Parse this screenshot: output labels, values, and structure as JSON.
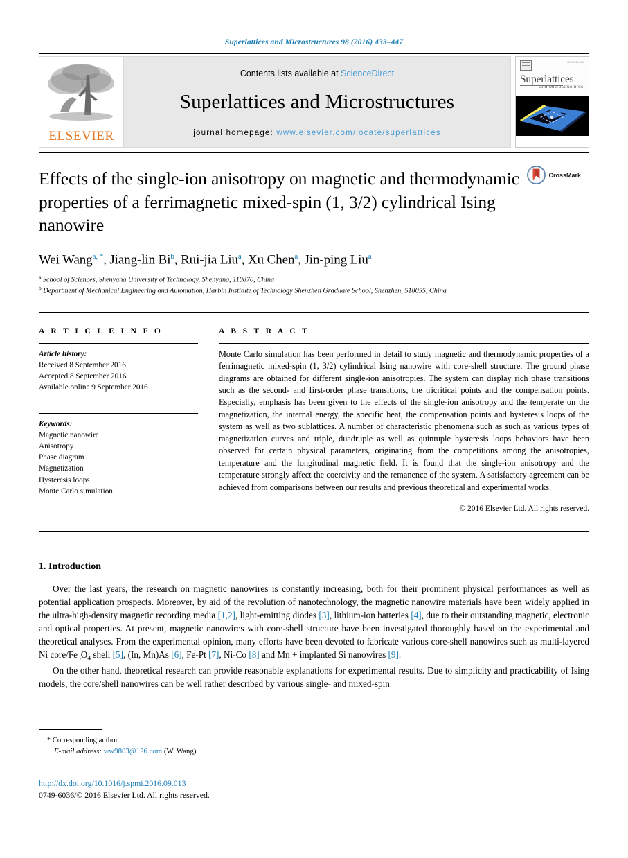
{
  "running_head": "Superlattices and Microstructures 98 (2016) 433–447",
  "masthead": {
    "publisher_logo_name": "ELSEVIER",
    "contents_prefix": "Contents lists available at ",
    "contents_link": "ScienceDirect",
    "journal_title": "Superlattices and Microstructures",
    "homepage_label": "journal homepage: ",
    "homepage_url": "www.elsevier.com/locate/superlattices",
    "cover": {
      "title_main": "Superlattices",
      "title_sub": "and Microstructures"
    }
  },
  "article": {
    "title": "Effects of the single-ion anisotropy on magnetic and thermodynamic properties of a ferrimagnetic mixed-spin (1, 3/2) cylindrical Ising nanowire",
    "crossmark_label": "CrossMark",
    "authors": [
      {
        "name": "Wei Wang",
        "marks": "a, *"
      },
      {
        "name": "Jiang-lin Bi",
        "marks": "b"
      },
      {
        "name": "Rui-jia Liu",
        "marks": "a"
      },
      {
        "name": "Xu Chen",
        "marks": "a"
      },
      {
        "name": "Jin-ping Liu",
        "marks": "a"
      }
    ],
    "affiliations": [
      {
        "mark": "a",
        "text": "School of Sciences, Shenyang University of Technology, Shenyang, 110870, China"
      },
      {
        "mark": "b",
        "text": "Department of Mechanical Engineering and Automation, Harbin Institute of Technology Shenzhen Graduate School, Shenzhen, 518055, China"
      }
    ]
  },
  "article_info": {
    "heading": "A R T I C L E   I N F O",
    "history_label": "Article history:",
    "history": [
      "Received 8 September 2016",
      "Accepted 8 September 2016",
      "Available online 9 September 2016"
    ],
    "keywords_label": "Keywords:",
    "keywords": [
      "Magnetic nanowire",
      "Anisotropy",
      "Phase diagram",
      "Magnetization",
      "Hysteresis loops",
      "Monte Carlo simulation"
    ]
  },
  "abstract": {
    "heading": "A B S T R A C T",
    "text": "Monte Carlo simulation has been performed in detail to study magnetic and thermodynamic properties of a ferrimagnetic mixed-spin (1, 3/2) cylindrical Ising nanowire with core-shell structure. The ground phase diagrams are obtained for different single-ion anisotropies. The system can display rich phase transitions such as the second- and first-order phase transitions, the tricritical points and the compensation points. Especially, emphasis has been given to the effects of the single-ion anisotropy and the temperate on the magnetization, the internal energy, the specific heat, the compensation points and hysteresis loops of the system as well as two sublattices. A number of characteristic phenomena such as such as various types of magnetization curves and triple, duadruple as well as quintuple hysteresis loops behaviors have been observed for certain physical parameters, originating from the competitions among the anisotropies, temperature and the longitudinal magnetic field. It is found that the single-ion anisotropy and the temperature strongly affect the coercivity and the remanence of the system. A satisfactory agreement can be achieved from comparisons between our results and previous theoretical and experimental works.",
    "copyright": "© 2016 Elsevier Ltd. All rights reserved."
  },
  "introduction": {
    "heading": "1. Introduction",
    "paragraph1_part1": "Over the last years, the research on magnetic nanowires is constantly increasing, both for their prominent physical performances as well as potential application prospects. Moreover, by aid of the revolution of nanotechnology, the magnetic nanowire materials have been widely applied in the ultra-high-density magnetic recording media ",
    "ref_12": "[1,2]",
    "paragraph1_part2": ", light-emitting diodes ",
    "ref_3": "[3]",
    "paragraph1_part3": ", lithium-ion batteries ",
    "ref_4": "[4]",
    "paragraph1_part4": ", due to their outstanding magnetic, electronic and optical properties. At present, magnetic nanowires with core-shell structure have been investigated thoroughly based on the experimental and theoretical analyses. From the experimental opinion, many efforts have been devoted to fabricate various core-shell nanowires such as multi-layered Ni core/Fe",
    "formula_sub": "3",
    "paragraph1_part5": "O",
    "formula_sub2": "4",
    "paragraph1_part6": " shell ",
    "ref_5": "[5]",
    "paragraph1_part7": ", (In, Mn)As ",
    "ref_6": "[6]",
    "paragraph1_part8": ", Fe-Pt ",
    "ref_7": "[7]",
    "paragraph1_part9": ", Ni-Co ",
    "ref_8": "[8]",
    "paragraph1_part10": " and Mn + implanted Si nanowires ",
    "ref_9": "[9]",
    "paragraph1_part11": ".",
    "paragraph2": "On the other hand, theoretical research can provide reasonable explanations for experimental results. Due to simplicity and practicability of Ising models, the core/shell nanowires can be well rather described by various single- and mixed-spin"
  },
  "footnotes": {
    "corresponding_star": "*",
    "corresponding_label": "Corresponding author.",
    "email_label": "E-mail address:",
    "email": "ww9803@126.com",
    "email_suffix": "(W. Wang)."
  },
  "footer": {
    "doi": "http://dx.doi.org/10.1016/j.spmi.2016.09.013",
    "issn_line": "0749-6036/© 2016 Elsevier Ltd. All rights reserved."
  },
  "colors": {
    "link_blue": "#1a7db6",
    "sciencedirect_blue": "#4a9ed4",
    "elsevier_orange": "#e87722"
  }
}
